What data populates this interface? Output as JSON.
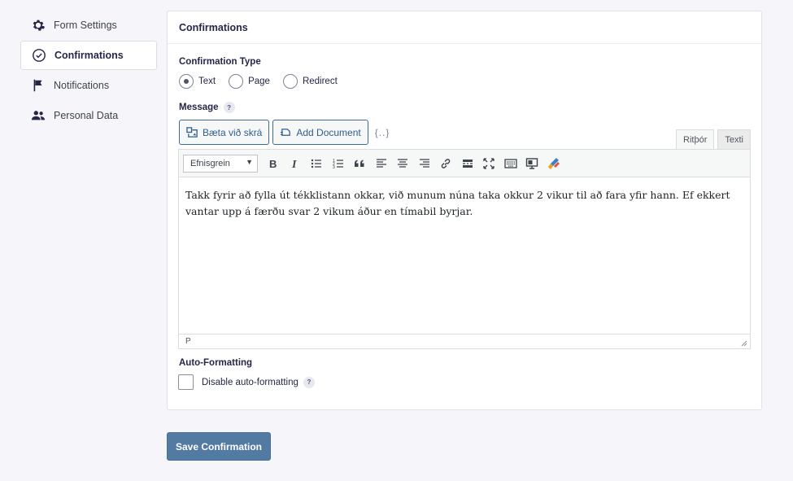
{
  "sidebar": {
    "items": [
      {
        "label": "Form Settings",
        "icon": "gear-icon"
      },
      {
        "label": "Confirmations",
        "icon": "check-circle-icon",
        "active": true
      },
      {
        "label": "Notifications",
        "icon": "flag-icon"
      },
      {
        "label": "Personal Data",
        "icon": "users-icon"
      }
    ]
  },
  "panel": {
    "title": "Confirmations",
    "confirmation_type": {
      "label": "Confirmation Type",
      "options": [
        {
          "label": "Text",
          "checked": true
        },
        {
          "label": "Page",
          "checked": false
        },
        {
          "label": "Redirect",
          "checked": false
        }
      ]
    },
    "message": {
      "label": "Message",
      "help": "?",
      "add_media_label": "Bæta við skrá",
      "add_document_label": "Add Document",
      "merge_tag": "{..}",
      "tabs": [
        "Ritþór",
        "Texti"
      ],
      "format_select": "Efnisgrein",
      "content": "Takk fyrir að fylla út tékklistann okkar, við munum núna taka okkur 2 vikur til að fara yfir hann. Ef ekkert vantar upp á færðu svar 2 vikum áður en tímabil byrjar.",
      "status_path": "P"
    },
    "auto_formatting": {
      "label": "Auto-Formatting",
      "checkbox_label": "Disable auto-formatting",
      "help": "?",
      "checked": false
    }
  },
  "save_button": "Save Confirmation",
  "colors": {
    "accent": "#527aa3",
    "media_button_border": "#3e6b96",
    "text": "#242748"
  }
}
